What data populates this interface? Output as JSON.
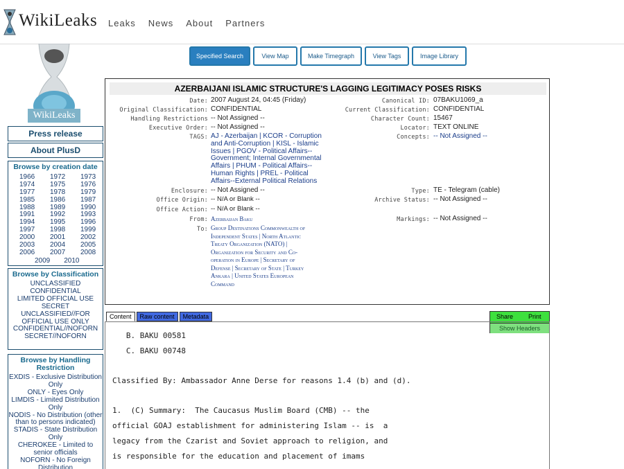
{
  "header": {
    "logo_text": "WikiLeaks",
    "nav": [
      "Leaks",
      "News",
      "About",
      "Partners"
    ]
  },
  "sidebar": {
    "logo_text": "WikiLeaks",
    "press_release": "Press release",
    "about_plusd": "About PlusD",
    "browse_creation_title": "Browse by creation date",
    "years": [
      "1966",
      "1972",
      "1973",
      "1974",
      "1975",
      "1976",
      "1977",
      "1978",
      "1979",
      "1985",
      "1986",
      "1987",
      "1988",
      "1989",
      "1990",
      "1991",
      "1992",
      "1993",
      "1994",
      "1995",
      "1996",
      "1997",
      "1998",
      "1999",
      "2000",
      "2001",
      "2002",
      "2003",
      "2004",
      "2005",
      "2006",
      "2007",
      "2008"
    ],
    "years_last": [
      "2009",
      "2010"
    ],
    "browse_class_title": "Browse by Classification",
    "classifications": [
      "UNCLASSIFIED",
      "CONFIDENTIAL",
      "LIMITED OFFICIAL USE",
      "SECRET",
      "UNCLASSIFIED//FOR",
      "OFFICIAL USE ONLY",
      "CONFIDENTIAL//NOFORN",
      "SECRET//NOFORN"
    ],
    "browse_handling_title": "Browse by Handling Restriction",
    "handling": [
      "EXDIS - Exclusive Distribution",
      "Only",
      "ONLY - Eyes Only",
      "LIMDIS - Limited Distribution",
      "Only",
      "NODIS - No Distribution (other",
      "than to persons indicated)",
      "STADIS - State Distribution",
      "Only",
      "CHEROKEE - Limited to",
      "senior officials",
      "NOFORN - No Foreign",
      "Distribution"
    ]
  },
  "tools": [
    "Specified Search",
    "View Map",
    "Make Timegraph",
    "View Tags",
    "Image Library"
  ],
  "doc": {
    "title": "AZERBAIJANI ISLAMIC STRUCTURE'S LAGGING LEGITIMACY POSES RISKS",
    "date_label": "Date:",
    "date": "2007 August 24, 04:45 (Friday)",
    "canonical_label": "Canonical ID:",
    "canonical": "07BAKU1069_a",
    "orig_class_label": "Original Classification:",
    "orig_class": "CONFIDENTIAL",
    "cur_class_label": "Current Classification:",
    "cur_class": "CONFIDENTIAL",
    "handling_label": "Handling Restrictions",
    "handling": "-- Not Assigned --",
    "char_count_label": "Character Count:",
    "char_count": "15467",
    "exec_order_label": "Executive Order:",
    "exec_order": "-- Not Assigned --",
    "locator_label": "Locator:",
    "locator": "TEXT ONLINE",
    "tags_label": "TAGS:",
    "tags": [
      "AJ - Azerbaijan | KCOR - Corruption",
      "and Anti-Corruption | KISL - Islamic",
      "Issues | PGOV - Political Affairs--",
      "Government; Internal Governmental",
      "Affairs | PHUM - Political Affairs--",
      "Human Rights | PREL - Political",
      "Affairs--External Political Relations"
    ],
    "concepts_label": "Concepts:",
    "concepts": "-- Not Assigned --",
    "enclosure_label": "Enclosure:",
    "enclosure": "-- Not Assigned --",
    "type_label": "Type:",
    "type": "TE - Telegram (cable)",
    "office_origin_label": "Office Origin:",
    "office_origin": "-- N/A or Blank --",
    "archive_label": "Archive Status:",
    "archive": "-- Not Assigned --",
    "office_action_label": "Office Action:",
    "office_action": "-- N/A or Blank --",
    "from_label": "From:",
    "from": "Azerbaijan Baku",
    "markings_label": "Markings:",
    "markings": "-- Not Assigned --",
    "to_label": "To:",
    "to": [
      "Group Destinations Commonwealth of",
      "Independent States | North Atlantic",
      "Treaty Organization (NATO) |",
      "Organization for Security and Co-",
      "operation in Europe | Secretary of",
      "Defense | Secretary of State | Turkey",
      "Ankara | United States European",
      "Command"
    ]
  },
  "tabs": [
    "Content",
    "Raw content",
    "Metadata"
  ],
  "actions": {
    "share": "Share",
    "print": "Print",
    "show_headers": "Show Headers"
  },
  "content_lines": [
    "   B. BAKU 00581",
    "   C. BAKU 00748",
    "Classified By: Ambassador Anne Derse for reasons 1.4 (b) and (d).",
    "1.  (C) Summary:  The Caucasus Muslim Board (CMB) -- the",
    "official GOAJ establishment for administering Islam -- is  a",
    "legacy from the Czarist and Soviet approach to religion, and",
    "is responsible for the education and placement of imams"
  ]
}
